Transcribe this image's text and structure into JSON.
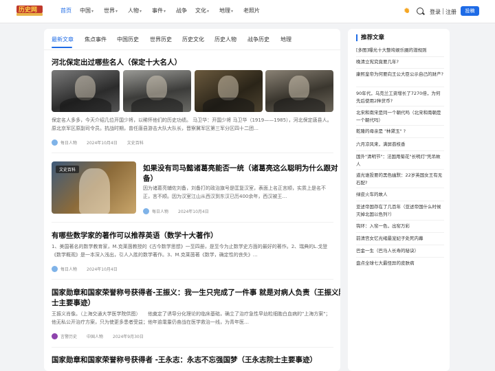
{
  "header": {
    "logo_text": "历史网",
    "nav": [
      {
        "label": "首页",
        "active": true,
        "caret": false
      },
      {
        "label": "中国",
        "active": false,
        "caret": true
      },
      {
        "label": "世界",
        "active": false,
        "caret": true
      },
      {
        "label": "人物",
        "active": false,
        "caret": true
      },
      {
        "label": "事件",
        "active": false,
        "caret": true
      },
      {
        "label": "战争",
        "active": false,
        "caret": false
      },
      {
        "label": "文化",
        "active": false,
        "caret": true
      },
      {
        "label": "地理",
        "active": false,
        "caret": true
      },
      {
        "label": "老照片",
        "active": false,
        "caret": false
      }
    ],
    "login": "登录",
    "register": "注册",
    "post": "投稿"
  },
  "tabs": [
    "最新文章",
    "焦点事件",
    "中国历史",
    "世界历史",
    "历史文化",
    "历史人物",
    "战争历史",
    "地理"
  ],
  "articles": [
    {
      "title": "河北保定出过哪些名人（保定十大名人）",
      "excerpt": "保定名人多多，今天介绍几位开国少将，以稀怀他们的历史功绩。 马卫华：开国少将 马卫华（1919——1985），河北保定唐县人。原北京军区原副司令员。抗战时期，曾任唐县游击大队大队长，晋察冀军区第三军分区四十二团…",
      "author": "每日人物",
      "date": "2024年10月4日",
      "category": "文史百科"
    },
    {
      "title": "如果没有司马懿诸葛亮能否一统（诸葛亮这么聪明为什么跟对备）",
      "title_line1": "如果没有司马懿诸葛亮能否一统（诸葛亮这么聪明为什么跟对",
      "title_line2": "备）",
      "badge": "文史百科",
      "excerpt": "因为诸葛亮辅佐刘备，刘备打的政治旗号是匡复汉室，表面上名正言顺，实质上是名不正，言不顺。因为汉室江山从西汉到东汉已历400余年，西汉被王…",
      "author": "每日人物",
      "date": "2024年10月4日"
    },
    {
      "title": "有哪些数学家的著作可以推荐英语（数学十大著作）",
      "excerpt": "1、美国著名的数学教育家，M.克莱茵教授的《古今数学思想》一至四册，是至今为止数学史方面的最好的著作。2、瑞典的L.戈登《数学概观》是一本深入浅出，引人入胜的数学著作。3、M.克莱茵著《数学，确定性的丧失》…",
      "author": "每日人物",
      "date": "2024年10月4日"
    },
    {
      "title_line1": "国家勋章和国家荣誉称号获得者-王振义：我一生只完成了一件事 就是对病人负责（王振义院",
      "title_line2": "士主要事迹）",
      "excerpt": "王振义肖像。（上海交通大学医学院供图）　　他奠定了诱导分化理论的临床基础，确立了治疗急性早幼粒细胞白血病的\"上海方案\"；他无私公开治疗方案，只为使更多患者受益；他年逾耄耋仍奋战在医学救治一线，为青年医…",
      "author": "言警历史",
      "date": "中国人物",
      "extra": "2024年9月30日"
    },
    {
      "title": "国家勋章和国家荣誉称号获得者 -王永志：永志不忘强国梦（王永志院士主要事迹）"
    }
  ],
  "sidebar": {
    "title": "推荐文章",
    "items": [
      "[多图]曝光十大整垮娱乐圈的潜规则",
      "晚清立宪究竟要几年?",
      "康熙皇帝为何要向王公大臣公示自己的财产?",
      "90年代，乌克兰工资增长了7270倍，为何先后使用2种货币?",
      "北宋和南宋是同一个朝代吗（北宋和南朝是一个朝代吗）",
      "乾隆的母亲是 \"林黛玉\" ?",
      "六月凉风来，满屏荔枝香",
      "国外\"清明节\"：法国用菊花\"长明灯\"凭吊故人",
      "道光谁投要的黑色幽默：22岁英国女王有无石配?",
      "绿皮火车的故人",
      "亚述帝国存在了几百年（亚述帝国什么时候灭掉北国以色列?）",
      "钩环：入窑一色，出窑万彩",
      "前清宫女忆光绪最宠妃子处死内幕",
      "巴金一生（巴马人长寿的秘诀）",
      "盘点全球七大最怪异的皮肤病"
    ]
  },
  "colors": {
    "accent": "#1e6be6",
    "background": "#f2f3f5"
  }
}
